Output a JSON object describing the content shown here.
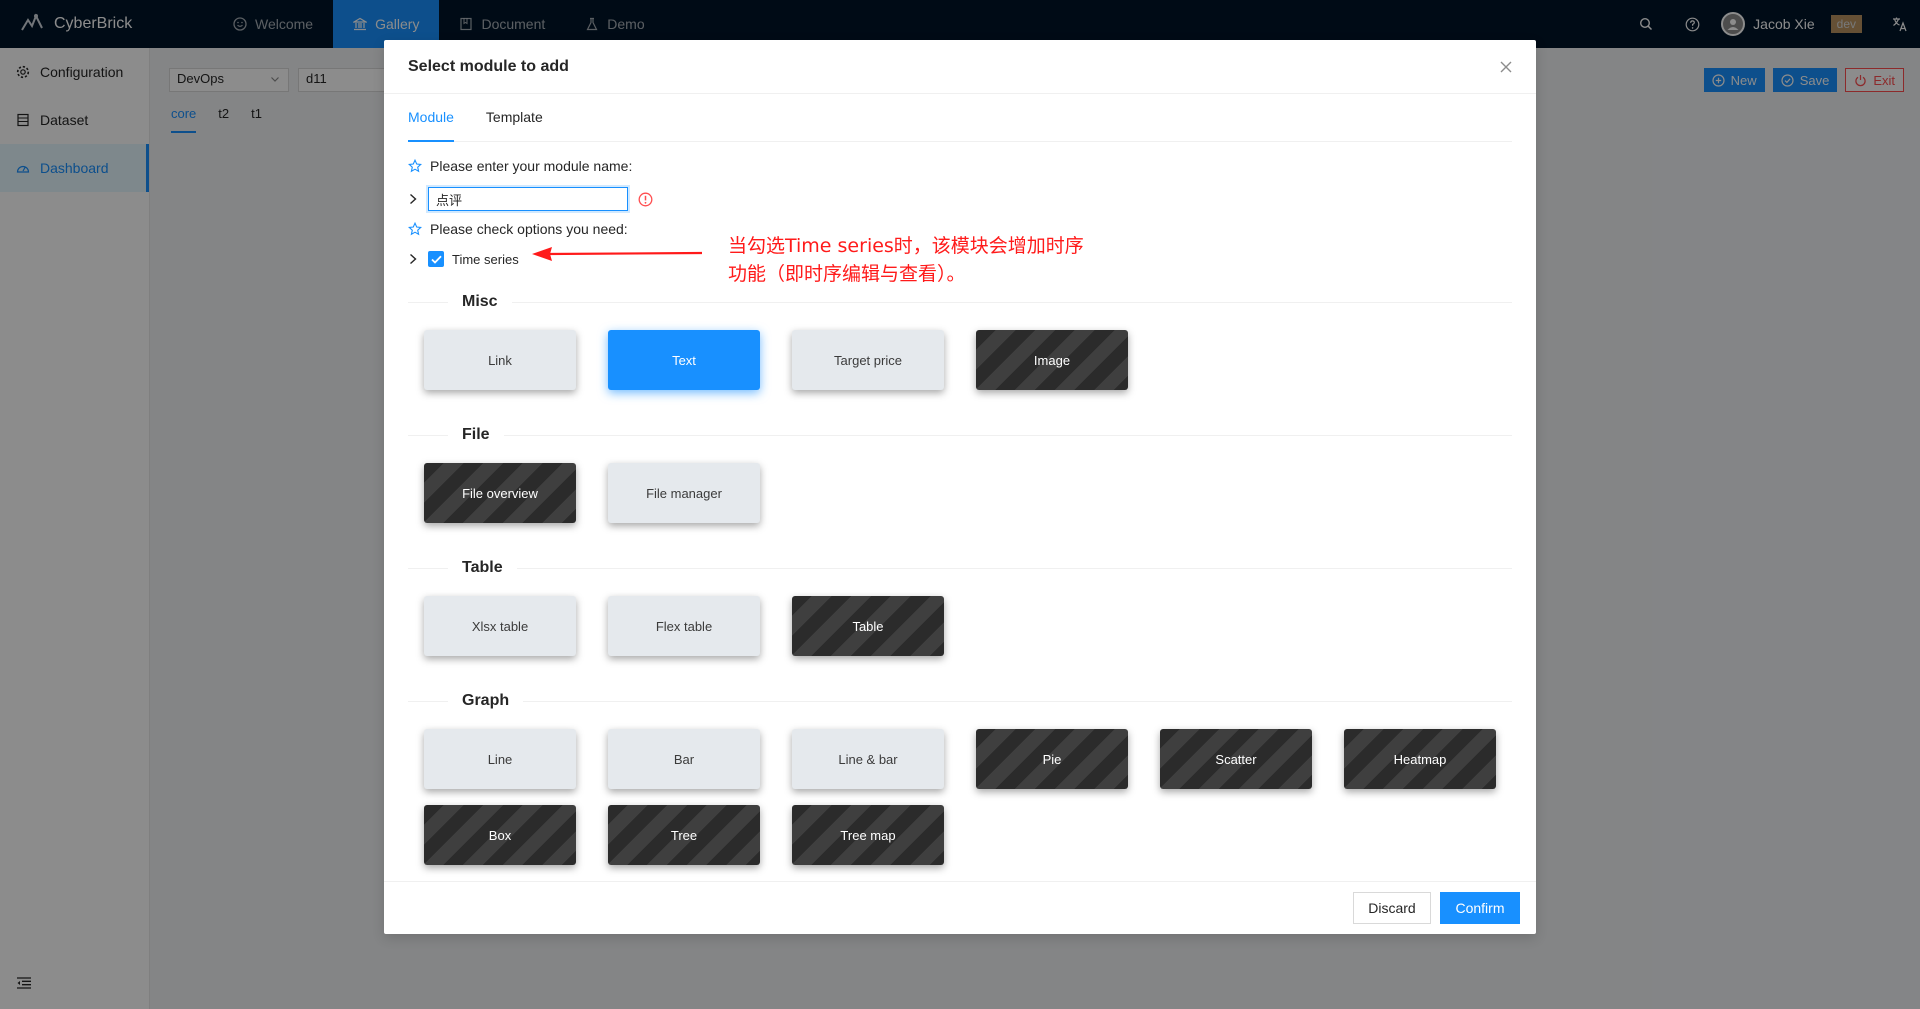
{
  "app": {
    "name": "CyberBrick"
  },
  "nav": [
    {
      "label": "Welcome",
      "icon": "smile-icon"
    },
    {
      "label": "Gallery",
      "icon": "bank-icon",
      "active": true
    },
    {
      "label": "Document",
      "icon": "book-icon"
    },
    {
      "label": "Demo",
      "icon": "experiment-icon"
    }
  ],
  "header": {
    "user_name": "Jacob Xie",
    "env_tag": "dev"
  },
  "sidebar": {
    "items": [
      {
        "label": "Configuration",
        "icon": "gear-icon"
      },
      {
        "label": "Dataset",
        "icon": "table-icon"
      },
      {
        "label": "Dashboard",
        "icon": "dashboard-icon",
        "active": true
      }
    ]
  },
  "content": {
    "selector_1": "DevOps",
    "selector_2": "d11",
    "tabs": [
      "core",
      "t2",
      "t1"
    ],
    "actions": {
      "new": "New",
      "save": "Save",
      "exit": "Exit"
    }
  },
  "modal": {
    "title": "Select module to add",
    "tabs": [
      "Module",
      "Template"
    ],
    "name_prompt": "Please enter your module name:",
    "name_value": "点评",
    "options_prompt": "Please check options you need:",
    "time_series_label": "Time series",
    "time_series_checked": true,
    "annotation": "当勾选Time series时，该模块会增加时序功能（即时序编辑与查看）。",
    "sections": [
      {
        "title": "Misc",
        "cards": [
          {
            "label": "Link",
            "style": "light"
          },
          {
            "label": "Text",
            "style": "selected"
          },
          {
            "label": "Target price",
            "style": "light"
          },
          {
            "label": "Image",
            "style": "dark"
          }
        ]
      },
      {
        "title": "File",
        "cards": [
          {
            "label": "File overview",
            "style": "dark"
          },
          {
            "label": "File manager",
            "style": "light"
          }
        ]
      },
      {
        "title": "Table",
        "cards": [
          {
            "label": "Xlsx table",
            "style": "light"
          },
          {
            "label": "Flex table",
            "style": "light"
          },
          {
            "label": "Table",
            "style": "dark"
          }
        ]
      },
      {
        "title": "Graph",
        "cards": [
          {
            "label": "Line",
            "style": "light"
          },
          {
            "label": "Bar",
            "style": "light"
          },
          {
            "label": "Line & bar",
            "style": "light"
          },
          {
            "label": "Pie",
            "style": "dark"
          },
          {
            "label": "Scatter",
            "style": "dark"
          },
          {
            "label": "Heatmap",
            "style": "dark"
          },
          {
            "label": "Box",
            "style": "dark"
          },
          {
            "label": "Tree",
            "style": "dark"
          },
          {
            "label": "Tree map",
            "style": "dark"
          }
        ]
      }
    ],
    "footer": {
      "discard": "Discard",
      "confirm": "Confirm"
    }
  },
  "colors": {
    "primary": "#1890ff",
    "header_bg": "#001529",
    "annotation": "#ff1a1a",
    "danger": "#ff4d4f"
  }
}
